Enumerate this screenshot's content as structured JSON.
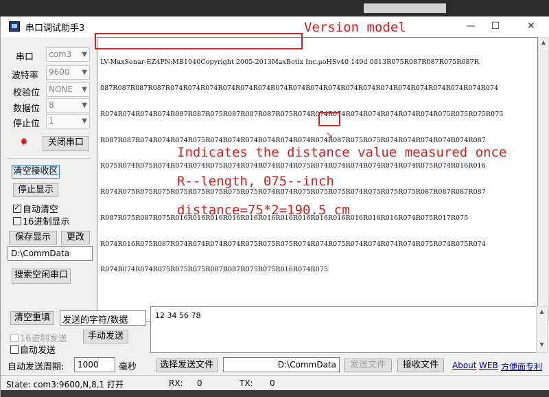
{
  "window": {
    "title": "串口调试助手3",
    "controls": {
      "minimize": "—",
      "maximize": "☐",
      "close": "✕"
    }
  },
  "settings": {
    "port_label": "串口",
    "port_value": "com3",
    "baud_label": "波特率",
    "baud_value": "9600",
    "parity_label": "校验位",
    "parity_value": "NONE",
    "databits_label": "数据位",
    "databits_value": "8",
    "stopbits_label": "停止位",
    "stopbits_value": "1",
    "close_port_button": "关闭串口"
  },
  "receive_controls": {
    "clear_receive": "清空接收区",
    "stop_display": "停止显示",
    "auto_clear": "自动清空",
    "hex_display": "16进制显示",
    "save_display": "保存显示",
    "change": "更改",
    "save_path": "D:\\CommData",
    "search_port": "搜索空闲串口"
  },
  "receive_area": {
    "lines": [
      "LV-MaxSonar-EZ4PN:MB1040Copyright 2005-2013MaxBotix Inc.µoHSv40 149d 0813R075R087R087R075R087R",
      "087R087R087R087R074R074R074R074R074R074R074R074R074R074R074R074R074R074R074R074R074R074R074",
      "R074R074R074R074R087R087R075R087R087R087R075R074R074R074R074R074R074R074R074R075R075R075R075",
      "R087R087R074R074R074R075R074R074R074R074R074R074R074R087R075R075R074R074R074R074R074R087",
      "R075R074R075R074R074R074R075R074R074R074R074R075R074R074R074R074R074R074R075R074R016R016",
      "R074R075R075R075R075R075R075R075R075R074R074R075R075R075R074R075R075R075R087R087R087R087",
      "R087R075R087R075R016R016R016R016R016R016R016R016R016R016R016R016R016R074R075R017R075",
      "R074R016R075R087R074R074R074R074R075R075R075R074R074R075R074R074R074R074R075R074R075R074",
      "R074R074R074R075R075R075R087R087R075R075R016R074R075"
    ]
  },
  "annotations": {
    "version_model": "Version model",
    "measure_line1": "Indicates the distance value measured once",
    "measure_line2": "R--length, 075--inch",
    "measure_line3": "distance=75*2=190.5 cm"
  },
  "send_controls": {
    "clear_resend": "清空重填",
    "send_type_field": "发送的字符/数据",
    "hex_send": "16进制发送",
    "manual_send": "手动发送",
    "auto_send": "自动发送",
    "auto_period_label": "自动发送周期:",
    "auto_period_value": "1000",
    "period_unit": "毫秒",
    "send_content": "12 34 56 78",
    "select_file": "选择发送文件",
    "file_path": "D:\\CommData",
    "send_file": "发送文件",
    "receive_file": "接收文件",
    "about_link": "About",
    "web_link": "WEB",
    "company_link": "方便面专利"
  },
  "status_bar": {
    "state": "State: com3:9600,N,8,1 打开",
    "rx_label": "RX:",
    "rx_value": "0",
    "tx_label": "TX:",
    "tx_value": "0"
  },
  "colors": {
    "annotation": "#d81e1e",
    "arrow": "#e0307a"
  }
}
